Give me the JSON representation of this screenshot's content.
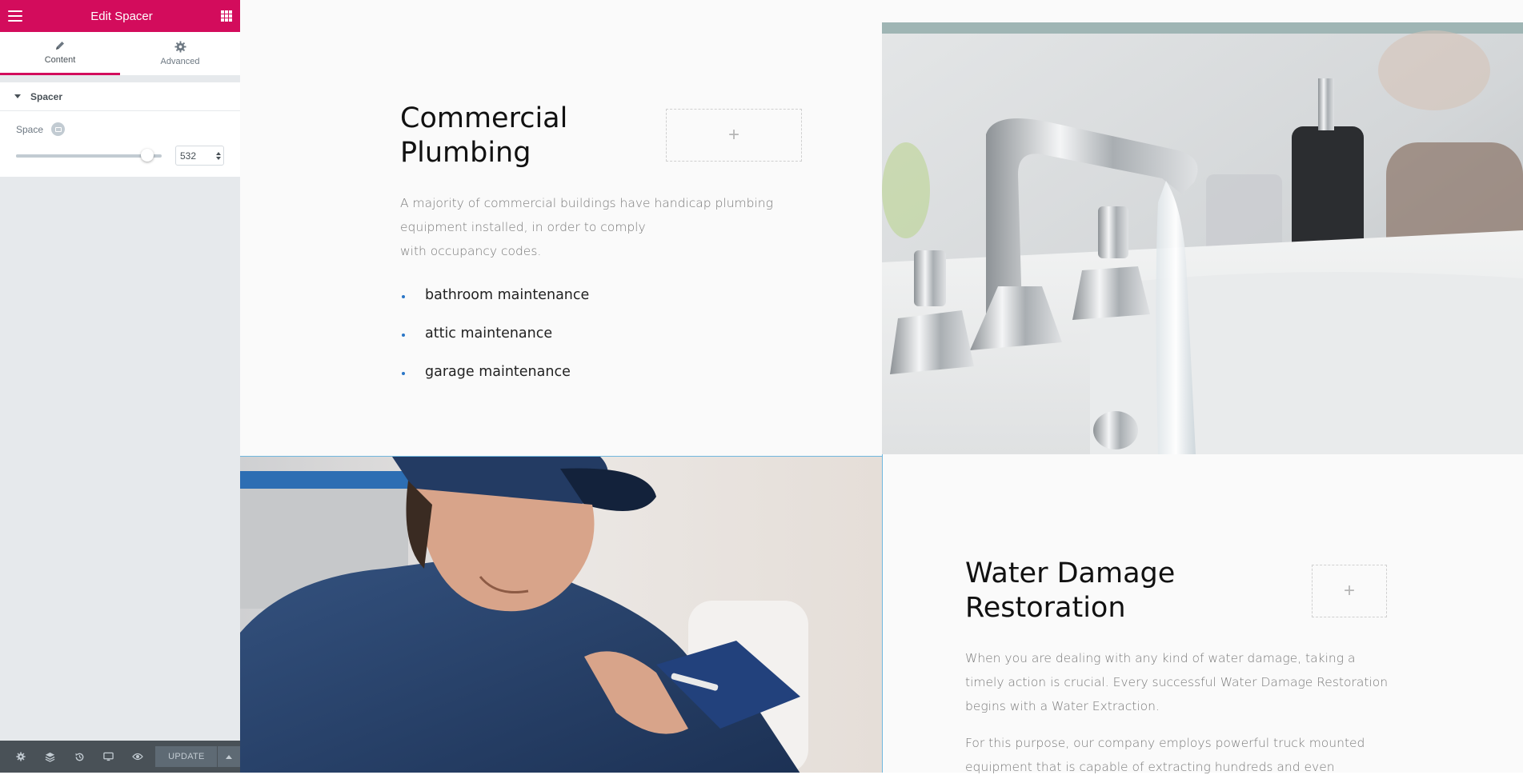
{
  "panel": {
    "title": "Edit Spacer",
    "tabs": [
      {
        "label": "Content",
        "icon": "pencil-icon",
        "active": true
      },
      {
        "label": "Advanced",
        "icon": "gear-icon",
        "active": false
      }
    ],
    "section_title": "Spacer",
    "control": {
      "label": "Space",
      "value": "532",
      "slider_fraction": 0.9
    },
    "footer": {
      "update_label": "UPDATE"
    },
    "colors": {
      "brand": "#d30c5c",
      "footer": "#495157"
    }
  },
  "canvas": {
    "commercial": {
      "heading": "Commercial Plumbing",
      "paragraph_lines": [
        "A majority of commercial buildings have handicap plumbing",
        "equipment installed, in order to comply",
        "with occupancy codes."
      ],
      "features": [
        "bathroom maintenance",
        "attic maintenance",
        "garage maintenance"
      ],
      "add_symbol": "+"
    },
    "water": {
      "heading": "Water Damage Restoration",
      "paragraph1_lines": [
        "When you are dealing with any kind of water damage, taking a",
        "timely action is crucial. Every successful Water Damage Restoration",
        "begins with a Water Extraction."
      ],
      "paragraph2_lines": [
        "For this purpose, our company employs powerful truck mounted",
        "equipment that is capable of extracting hundreds and even"
      ],
      "add_symbol": "+"
    },
    "images": {
      "faucet": "faucet-photo",
      "plumber": "plumber-photo"
    }
  }
}
